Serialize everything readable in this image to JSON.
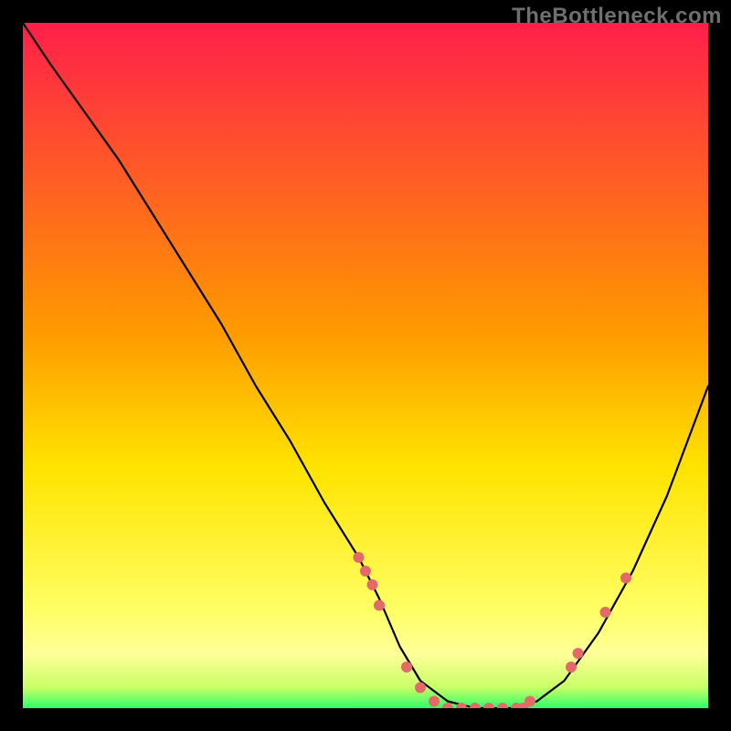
{
  "watermark": {
    "text": "TheBottleneck.com"
  },
  "chart_data": {
    "type": "line",
    "title": "",
    "xlabel": "",
    "ylabel": "",
    "xlim": [
      0,
      100
    ],
    "ylim": [
      0,
      100
    ],
    "grid": false,
    "legend": false,
    "background_gradient": {
      "top_color": "#ff1f4a",
      "mid_color": "#ffe400",
      "bottom_band_color": "#ffff99",
      "bottom_edge_color": "#2dff6b"
    },
    "curve": {
      "description": "V-shaped bottleneck curve. Starts near the top-left, descends steeply to ~x=55, runs flat along the bottom to ~x=72, then rises toward the right edge.",
      "x": [
        0,
        4,
        9,
        14,
        19,
        24,
        29,
        34,
        39,
        44,
        49,
        52,
        55,
        58,
        62,
        66,
        70,
        72,
        75,
        79,
        84,
        89,
        94,
        100
      ],
      "y": [
        100,
        94,
        87,
        80,
        72,
        64,
        56,
        47,
        39,
        30,
        22,
        16,
        9,
        4,
        1,
        0,
        0,
        0,
        1,
        4,
        11,
        20,
        31,
        47
      ]
    },
    "markers": {
      "color": "#e46a6a",
      "radius": 6,
      "points": [
        {
          "x": 49,
          "y": 22
        },
        {
          "x": 50,
          "y": 20
        },
        {
          "x": 51,
          "y": 18
        },
        {
          "x": 52,
          "y": 15
        },
        {
          "x": 56,
          "y": 6
        },
        {
          "x": 58,
          "y": 3
        },
        {
          "x": 60,
          "y": 1
        },
        {
          "x": 62,
          "y": 0
        },
        {
          "x": 64,
          "y": 0
        },
        {
          "x": 66,
          "y": 0
        },
        {
          "x": 68,
          "y": 0
        },
        {
          "x": 70,
          "y": 0
        },
        {
          "x": 72,
          "y": 0
        },
        {
          "x": 73,
          "y": 0
        },
        {
          "x": 74,
          "y": 1
        },
        {
          "x": 80,
          "y": 6
        },
        {
          "x": 81,
          "y": 8
        },
        {
          "x": 85,
          "y": 14
        },
        {
          "x": 88,
          "y": 19
        }
      ]
    }
  }
}
